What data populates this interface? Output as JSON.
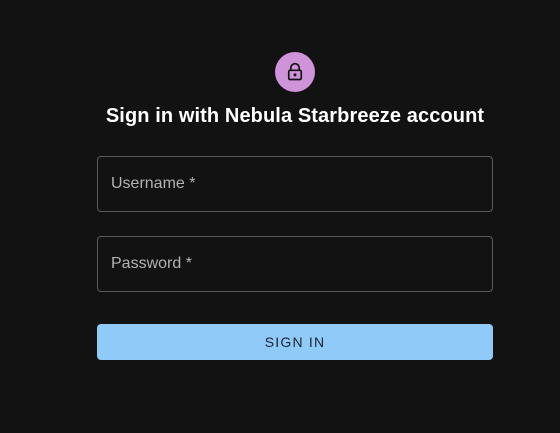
{
  "header": {
    "avatar_icon": "lock-icon",
    "avatar_color": "#ce93d8",
    "title": "Sign in with Nebula Starbreeze account"
  },
  "form": {
    "username": {
      "label": "Username *",
      "value": ""
    },
    "password": {
      "label": "Password *",
      "value": ""
    },
    "submit_label": "SIGN IN",
    "submit_color": "#90caf9"
  },
  "theme": {
    "background": "#121212"
  }
}
